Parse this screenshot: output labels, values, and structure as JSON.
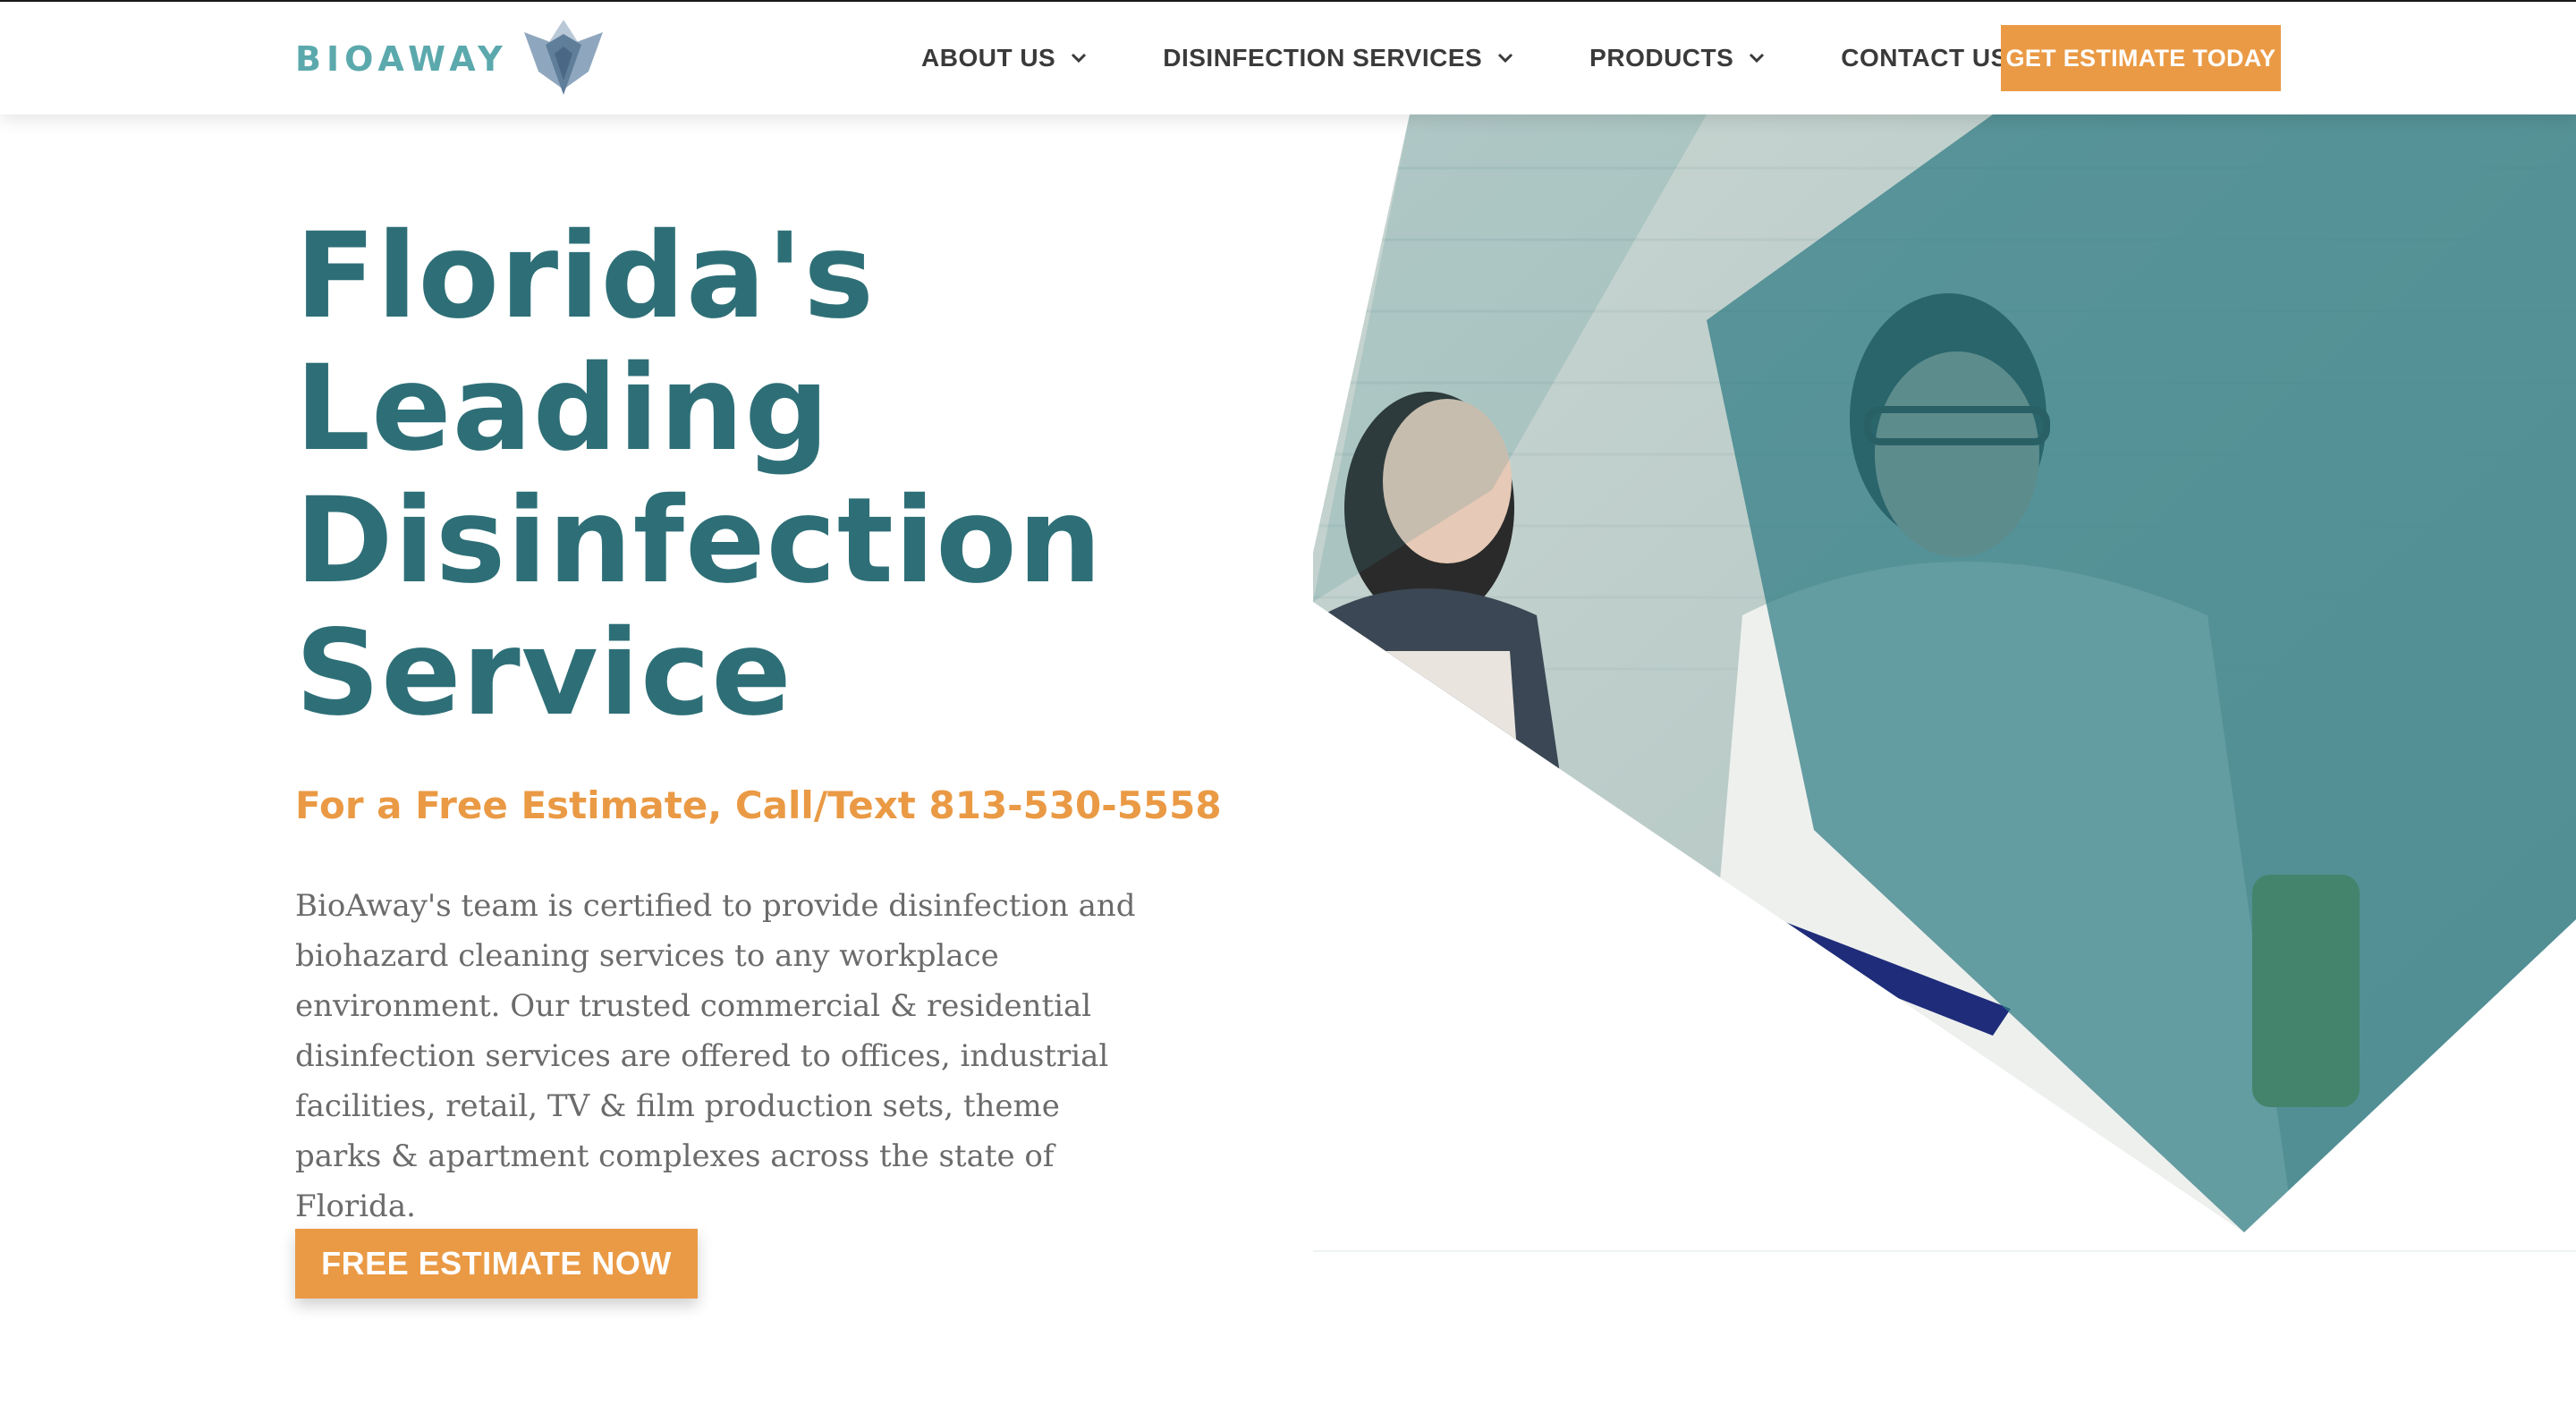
{
  "header": {
    "logo_text": "BIOAWAY",
    "nav": [
      {
        "label": "ABOUT US",
        "icon": "chevron-down-icon"
      },
      {
        "label": "DISINFECTION SERVICES",
        "icon": "chevron-down-icon"
      },
      {
        "label": "PRODUCTS",
        "icon": "chevron-down-icon"
      },
      {
        "label": "CONTACT US"
      }
    ],
    "cta_label": "GET ESTIMATE TODAY"
  },
  "hero": {
    "headline_lines": [
      "Florida's",
      "Leading",
      "Disinfection",
      "Service"
    ],
    "subhead": "For a Free Estimate, Call/Text 813-530-5558",
    "body": "BioAway's team is certified to provide disinfection and biohazard cleaning services to any workplace environment. Our trusted commercial & residential disinfection services are offered to offices, industrial facilities, retail, TV & film production sets, theme parks & apartment complexes across the state of Florida.",
    "cta_label": "FREE ESTIMATE NOW"
  },
  "colors": {
    "brand_teal": "#2e6f77",
    "logo_teal": "#5ba9ad",
    "accent_orange": "#ea9a45",
    "body_gray": "#6b6b6b"
  }
}
